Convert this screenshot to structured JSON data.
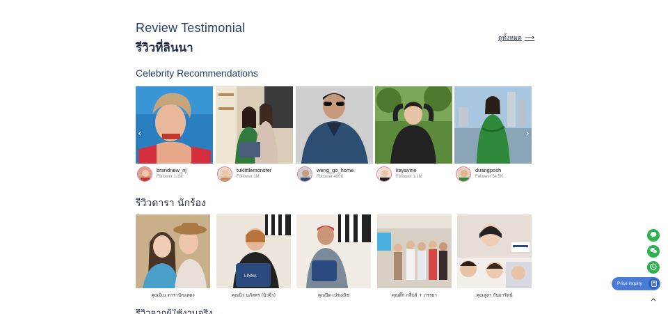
{
  "header": {
    "title_en": "Review Testimonial",
    "title_th": "รีวิวที่ลินนา",
    "see_all_label": "ดูทั้งหมด",
    "see_all_arrow": "⟶"
  },
  "celebrity_section": {
    "title": "Celebrity Recommendations",
    "prev_arrow": "‹",
    "next_arrow": "›",
    "items": [
      {
        "name": "brandnew_nj",
        "followers": "Follower 1.1M"
      },
      {
        "name": "tuklittlemonster",
        "followers": "Follower 1M"
      },
      {
        "name": "weng_go_home",
        "followers": "Follower 400K"
      },
      {
        "name": "kayavine",
        "followers": "Follower 1.1M"
      },
      {
        "name": "duangposh",
        "followers": "Follower 54.5K"
      }
    ]
  },
  "star_section": {
    "title": "รีวิวดารา นักร้อง",
    "items": [
      {
        "caption": "คุณมิเน ดารานักแสดง"
      },
      {
        "caption": "คุณนิว นภัสสร (นิวจิ๋ว)"
      },
      {
        "caption": "คุณปิด เปรมณัช"
      },
      {
        "caption": "คุณติ๊ก กลีบส์ + ภรรยา"
      },
      {
        "caption": "คุณลูลา กันยารัตน์"
      }
    ]
  },
  "next_section_partial": "รีวิวจากผู้ใช้งานจริง",
  "floating": {
    "line_icon": "line-icon",
    "wechat_icon": "wechat-icon",
    "whatsapp_icon": "whatsapp-icon",
    "price_inquiry_label": "Price inquiry",
    "scroll_top": "^"
  },
  "colors": {
    "heading": "#2b3f6b",
    "green": "#2bb24c",
    "button_blue": "#4a7bd4"
  }
}
